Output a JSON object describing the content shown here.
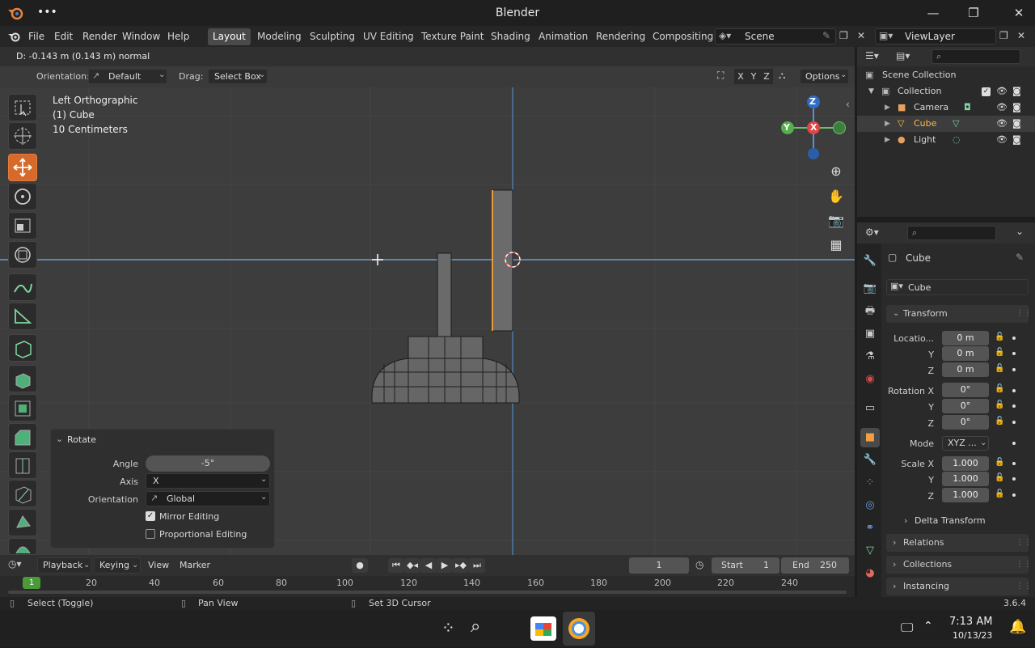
{
  "window": {
    "title": "Blender",
    "minimize": "—",
    "maximize": "❐",
    "close": "✕",
    "more": "•••"
  },
  "menu": {
    "file": "File",
    "edit": "Edit",
    "render": "Render",
    "window": "Window",
    "help": "Help"
  },
  "workspaces": [
    "Layout",
    "Modeling",
    "Sculpting",
    "UV Editing",
    "Texture Paint",
    "Shading",
    "Animation",
    "Rendering",
    "Compositing"
  ],
  "scene": {
    "name": "Scene",
    "view_layer": "ViewLayer"
  },
  "viewport": {
    "header_text": "D: -0.143 m (0.143 m) normal",
    "orientation_label": "Orientation:",
    "orientation_value": "Default",
    "drag_label": "Drag:",
    "drag_value": "Select Box",
    "axes": [
      "X",
      "Y",
      "Z"
    ],
    "options": "Options",
    "view_name": "Left Orthographic",
    "object_info": "(1) Cube",
    "scale_info": "10 Centimeters",
    "gizmo": {
      "z": "Z",
      "y": "Y",
      "x": "X"
    }
  },
  "rotate_panel": {
    "title": "Rotate",
    "angle_label": "Angle",
    "angle_value": "-5°",
    "axis_label": "Axis",
    "axis_value": "X",
    "orientation_label": "Orientation",
    "orientation_value": "Global",
    "mirror_label": "Mirror Editing",
    "mirror_checked": true,
    "proportional_label": "Proportional Editing",
    "proportional_checked": false
  },
  "outliner": {
    "root": "Scene Collection",
    "collection": "Collection",
    "items": [
      {
        "name": "Camera",
        "color": "#e8a060"
      },
      {
        "name": "Cube",
        "color": "#ffb84a"
      },
      {
        "name": "Light",
        "color": "#e8a060"
      }
    ]
  },
  "properties": {
    "object_name": "Cube",
    "data_name": "Cube",
    "transform_label": "Transform",
    "location_label": "Locatio...",
    "location": [
      "0 m",
      "0 m",
      "0 m"
    ],
    "rotation_label": "Rotation X",
    "rotation": [
      "0°",
      "0°",
      "0°"
    ],
    "mode_label": "Mode",
    "mode_value": "XYZ ...",
    "scale_label": "Scale X",
    "scale": [
      "1.000",
      "1.000",
      "1.000"
    ],
    "y_label": "Y",
    "z_label": "Z",
    "delta_label": "Delta Transform",
    "sections": [
      "Relations",
      "Collections",
      "Instancing"
    ]
  },
  "timeline": {
    "playback": "Playback",
    "keying": "Keying",
    "view": "View",
    "marker": "Marker",
    "current_frame": "1",
    "start_label": "Start",
    "start_value": "1",
    "end_label": "End",
    "end_value": "250",
    "ticks": [
      "1",
      "20",
      "40",
      "60",
      "80",
      "100",
      "120",
      "140",
      "160",
      "180",
      "200",
      "220",
      "240"
    ]
  },
  "status": {
    "select": "Select (Toggle)",
    "pan": "Pan View",
    "cursor": "Set 3D Cursor",
    "version": "3.6.4"
  },
  "taskbar": {
    "time": "7:13 AM",
    "date": "10/13/23"
  }
}
